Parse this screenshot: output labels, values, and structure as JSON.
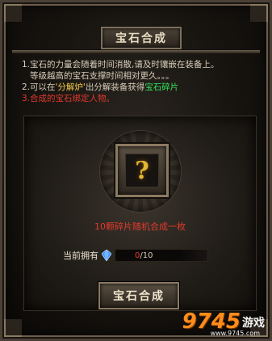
{
  "window": {
    "title": "宝石合成"
  },
  "description": {
    "line1": "1.宝石的力量会随着时间消散,请及时镶嵌在装备上。",
    "line2": "等级越高的宝石支撑时间相对更久。。。",
    "line3_a": "2.可以在",
    "line3_b": "'分解炉'",
    "line3_c": "出分解装备获得",
    "line3_d": "宝石碎片",
    "line4": "3.合成的宝石绑定人物。"
  },
  "slot": {
    "symbol": "?"
  },
  "panel": {
    "info": "10颗碎片随机合成一枚"
  },
  "ownership": {
    "label": "当前拥有",
    "current": "0",
    "total": "/10"
  },
  "buttons": {
    "synthesize": "宝石合成"
  },
  "watermark": {
    "brand_num": "9745",
    "brand_txt": "游戏",
    "url": "www.9745.com"
  },
  "colors": {
    "green": "#33e35c",
    "red": "#e23a2e",
    "yellow": "#f0c84a",
    "accent_orange": "#ff8c1a"
  },
  "icons": {
    "gem": "gem-icon",
    "slot_question": "question-icon"
  }
}
